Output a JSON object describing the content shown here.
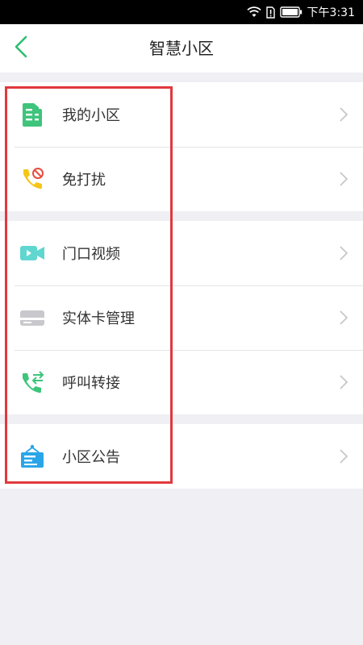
{
  "status_bar": {
    "time": "下午3:31"
  },
  "header": {
    "title": "智慧小区",
    "back_icon": "chevron-left-icon"
  },
  "colors": {
    "accent": "#2ebf6f",
    "highlight": "#e0393d"
  },
  "groups": [
    {
      "items": [
        {
          "label": "我的小区",
          "icon": "community-building-icon"
        },
        {
          "label": "免打扰",
          "icon": "do-not-disturb-phone-icon"
        }
      ]
    },
    {
      "items": [
        {
          "label": "门口视频",
          "icon": "video-camera-icon"
        },
        {
          "label": "实体卡管理",
          "icon": "card-icon"
        },
        {
          "label": "呼叫转接",
          "icon": "call-transfer-icon"
        }
      ]
    },
    {
      "items": [
        {
          "label": "小区公告",
          "icon": "announcement-board-icon"
        }
      ]
    }
  ]
}
